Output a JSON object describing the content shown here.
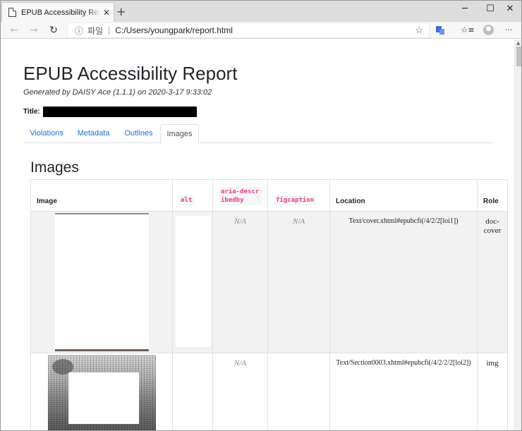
{
  "browser": {
    "tab_title": "EPUB Accessibility Report by DAISY Ace",
    "tab_close": "✕",
    "new_tab": "+",
    "window_controls": {
      "minimize": "─",
      "maximize": "☐",
      "close": "✕"
    },
    "nav": {
      "back": "←",
      "forward": "→",
      "reload": "↻"
    },
    "address": {
      "info_icon": "ⓘ",
      "protocol_label": "파일",
      "separator": "|",
      "url": "C:/Users/youngpark/report.html",
      "star": "☆"
    },
    "toolbar": {
      "favorites": "☆≡",
      "more": "···"
    }
  },
  "report": {
    "title": "EPUB Accessibility Report",
    "generated": "Generated by DAISY Ace (1.1.1) on 2020-3-17 9:33:02",
    "title_label": "Title:",
    "tabs": [
      {
        "label": "Violations",
        "active": false
      },
      {
        "label": "Metadata",
        "active": false
      },
      {
        "label": "Outlines",
        "active": false
      },
      {
        "label": "Images",
        "active": true
      }
    ],
    "section_title": "Images",
    "table": {
      "headers": {
        "image": "Image",
        "alt": "alt",
        "aria_describedby": "aria-describedby",
        "figcaption": "figcaption",
        "location": "Location",
        "role": "Role"
      },
      "rows": [
        {
          "alt": "",
          "aria_describedby": "N/A",
          "figcaption": "N/A",
          "location": "Text/cover.xhtml#epubcfi(/4/2/2[loi1])",
          "role": "doc-cover"
        },
        {
          "alt": "",
          "aria_describedby": "N/A",
          "figcaption": "",
          "location": "Text/Section0003.xhtml#epubcfi(/4/2/2/2[loi2])",
          "role": "img"
        }
      ]
    }
  }
}
